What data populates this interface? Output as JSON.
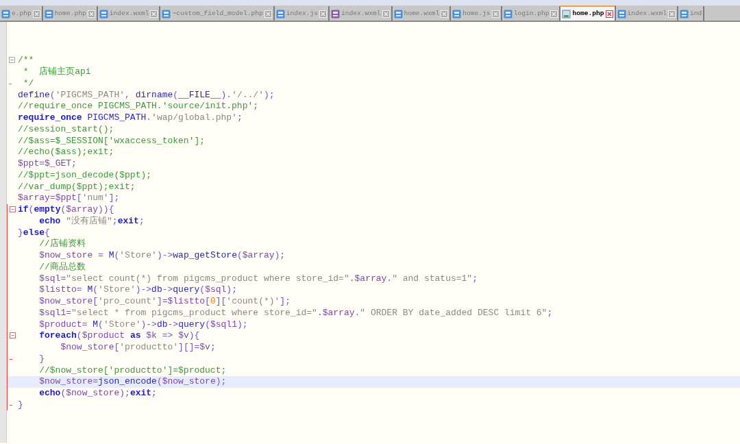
{
  "tabs": [
    {
      "label": "e.php",
      "kind": "blue",
      "selected": false
    },
    {
      "label": "home.php",
      "kind": "blue",
      "selected": false
    },
    {
      "label": "index.wxml",
      "kind": "blue",
      "selected": false
    },
    {
      "label": "~custom_field_model.php",
      "kind": "blue",
      "selected": false
    },
    {
      "label": "index.js",
      "kind": "blue",
      "selected": false
    },
    {
      "label": "index.wxml",
      "kind": "purple",
      "selected": false
    },
    {
      "label": "home.wxml",
      "kind": "blue",
      "selected": false
    },
    {
      "label": "home.js",
      "kind": "blue",
      "selected": false
    },
    {
      "label": "login.php",
      "kind": "blue",
      "selected": false
    },
    {
      "label": "home.php",
      "kind": "blue",
      "selected": true
    },
    {
      "label": "index.wxml",
      "kind": "blue",
      "selected": false
    },
    {
      "label": "ind",
      "kind": "blue",
      "selected": false
    }
  ],
  "lines": [
    {
      "text": "/**",
      "kind": "comment",
      "fold_start": true,
      "fold_end": false,
      "scope": false,
      "highlighted": false
    },
    {
      "text": " *  店铺主页api",
      "kind": "comment",
      "fold_start": false,
      "fold_end": false,
      "scope": false,
      "highlighted": false
    },
    {
      "text": " */",
      "kind": "comment",
      "fold_start": false,
      "fold_end": true,
      "scope": false,
      "highlighted": false
    },
    {
      "text": "define('PIGCMS_PATH', dirname(__FILE__).'/../');",
      "kind": "code",
      "fold_start": false,
      "fold_end": false,
      "scope": false,
      "highlighted": false
    },
    {
      "text": "//require_once PIGCMS_PATH.'source/init.php';",
      "kind": "comment",
      "fold_start": false,
      "fold_end": false,
      "scope": false,
      "highlighted": false
    },
    {
      "text": "require_once PIGCMS_PATH.'wap/global.php';",
      "kind": "code",
      "fold_start": false,
      "fold_end": false,
      "scope": false,
      "highlighted": false
    },
    {
      "text": "//session_start();",
      "kind": "comment",
      "fold_start": false,
      "fold_end": false,
      "scope": false,
      "highlighted": false
    },
    {
      "text": "//$ass=$_SESSION['wxaccess_token'];",
      "kind": "comment",
      "fold_start": false,
      "fold_end": false,
      "scope": false,
      "highlighted": false
    },
    {
      "text": "//echo($ass);exit;",
      "kind": "comment",
      "fold_start": false,
      "fold_end": false,
      "scope": false,
      "highlighted": false
    },
    {
      "text": "$ppt=$_GET;",
      "kind": "code",
      "fold_start": false,
      "fold_end": false,
      "scope": false,
      "highlighted": false
    },
    {
      "text": "//$ppt=json_decode($ppt);",
      "kind": "comment",
      "fold_start": false,
      "fold_end": false,
      "scope": false,
      "highlighted": false
    },
    {
      "text": "//var_dump($ppt);exit;",
      "kind": "comment",
      "fold_start": false,
      "fold_end": false,
      "scope": false,
      "highlighted": false
    },
    {
      "text": "$array=$ppt['num'];",
      "kind": "code",
      "fold_start": false,
      "fold_end": false,
      "scope": false,
      "highlighted": false
    },
    {
      "text": "if(empty($array)){",
      "kind": "code",
      "fold_start": true,
      "fold_end": false,
      "scope": true,
      "highlighted": false
    },
    {
      "text": "    echo \"没有店铺\";exit;",
      "kind": "code",
      "fold_start": false,
      "fold_end": false,
      "scope": true,
      "highlighted": false
    },
    {
      "text": "}else{",
      "kind": "code",
      "fold_start": false,
      "fold_end": false,
      "scope": true,
      "highlighted": false
    },
    {
      "text": "    //店铺资料",
      "kind": "comment",
      "fold_start": false,
      "fold_end": false,
      "scope": true,
      "highlighted": false
    },
    {
      "text": "    $now_store = M('Store')->wap_getStore($array);",
      "kind": "code",
      "fold_start": false,
      "fold_end": false,
      "scope": true,
      "highlighted": false
    },
    {
      "text": "    //商品总数",
      "kind": "comment",
      "fold_start": false,
      "fold_end": false,
      "scope": true,
      "highlighted": false
    },
    {
      "text": "    $sql=\"select count(*) from pigcms_product where store_id=\".$array.\" and status=1\";",
      "kind": "code",
      "fold_start": false,
      "fold_end": false,
      "scope": true,
      "highlighted": false
    },
    {
      "text": "    $listto= M('Store')->db->query($sql);",
      "kind": "code",
      "fold_start": false,
      "fold_end": false,
      "scope": true,
      "highlighted": false
    },
    {
      "text": "    $now_store['pro_count']=$listto[0]['count(*)'];",
      "kind": "code",
      "fold_start": false,
      "fold_end": false,
      "scope": true,
      "highlighted": false
    },
    {
      "text": "    $sql1=\"select * from pigcms_product where store_id=\".$array.\" ORDER BY date_added DESC limit 6\";",
      "kind": "code",
      "fold_start": false,
      "fold_end": false,
      "scope": true,
      "highlighted": false
    },
    {
      "text": "    $product= M('Store')->db->query($sql1);",
      "kind": "code",
      "fold_start": false,
      "fold_end": false,
      "scope": true,
      "highlighted": false
    },
    {
      "text": "    foreach($product as $k => $v){",
      "kind": "code",
      "fold_start": true,
      "fold_end": false,
      "scope": true,
      "highlighted": false
    },
    {
      "text": "        $now_store['productto'][]=$v;",
      "kind": "code",
      "fold_start": false,
      "fold_end": false,
      "scope": true,
      "highlighted": false
    },
    {
      "text": "    }",
      "kind": "code",
      "fold_start": false,
      "fold_end": true,
      "scope": true,
      "highlighted": false
    },
    {
      "text": "    //$now_store['productto']=$product;",
      "kind": "comment",
      "fold_start": false,
      "fold_end": false,
      "scope": true,
      "highlighted": false
    },
    {
      "text": "    $now_store=json_encode($now_store);",
      "kind": "code",
      "fold_start": false,
      "fold_end": false,
      "scope": true,
      "highlighted": true
    },
    {
      "text": "    echo($now_store);exit;",
      "kind": "code",
      "fold_start": false,
      "fold_end": false,
      "scope": true,
      "highlighted": false
    },
    {
      "text": "}",
      "kind": "code",
      "fold_start": false,
      "fold_end": true,
      "scope": true,
      "highlighted": false
    }
  ]
}
